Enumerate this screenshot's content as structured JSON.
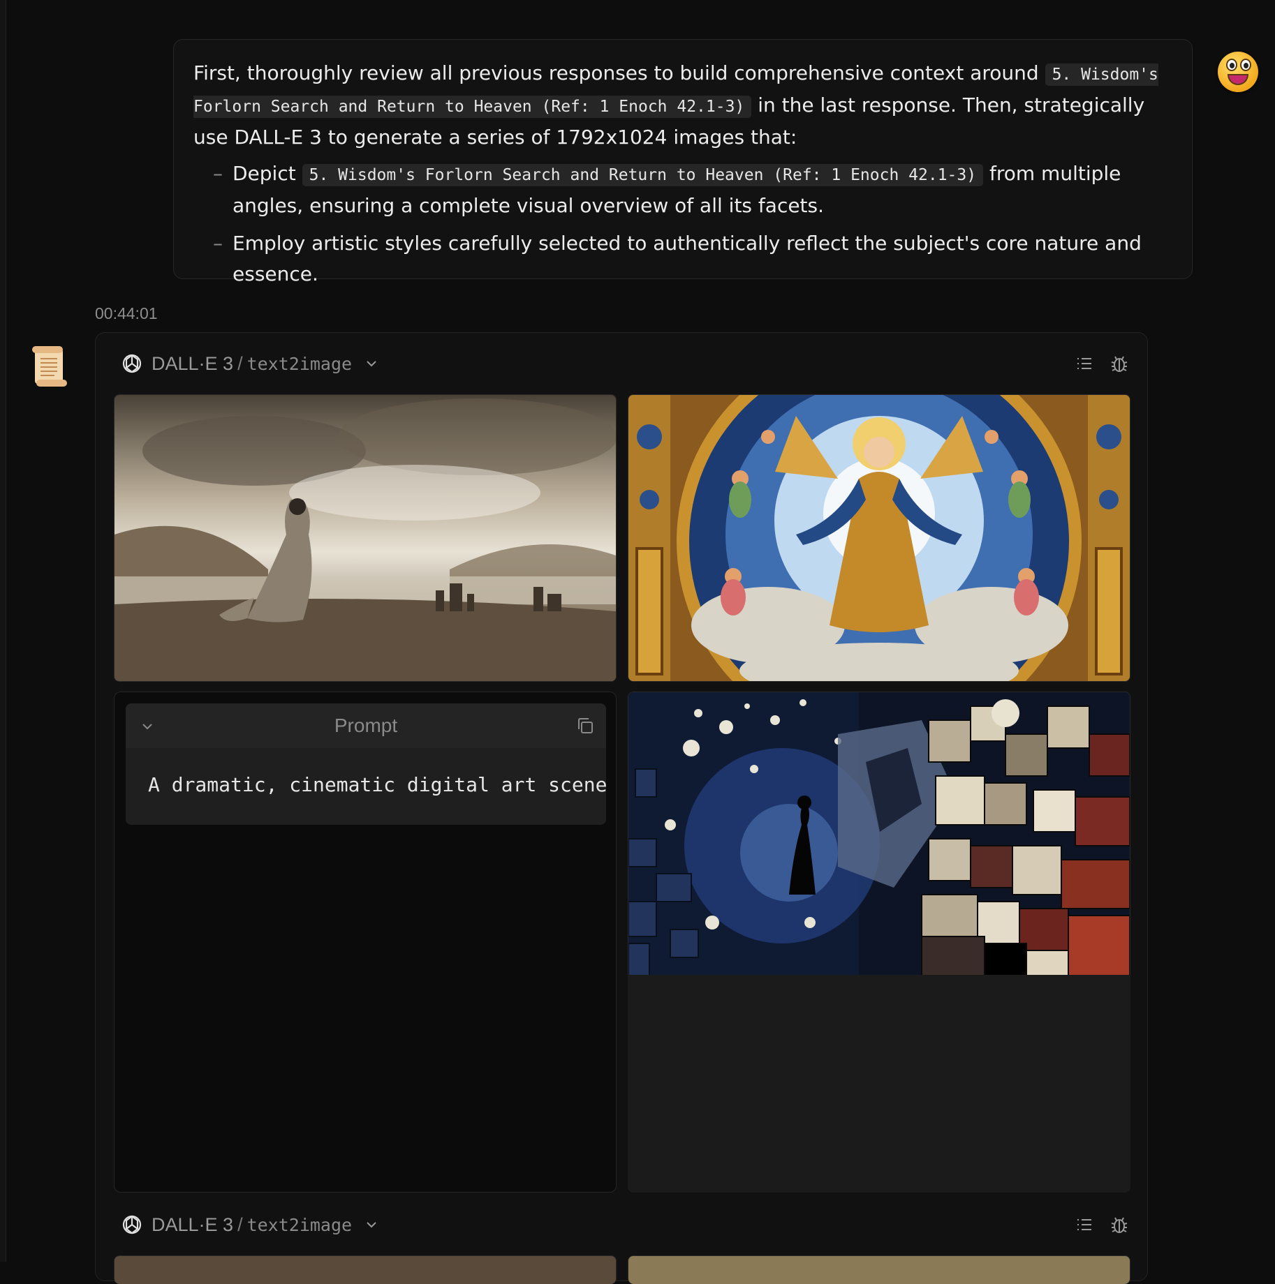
{
  "user_message": {
    "intro_before": "First, thoroughly review all previous responses to build comprehensive context around",
    "ref_code": "5. Wisdom's Forlorn Search and Return to Heaven (Ref: 1 Enoch 42.1-3)",
    "intro_after": "in the last response. Then, strategically use DALL-E 3 to generate a series of 1792x1024 images that:",
    "bullets": [
      {
        "dash": "–",
        "before": "Depict",
        "code": "5. Wisdom's Forlorn Search and Return to Heaven (Ref: 1 Enoch 42.1-3)",
        "after": "from multiple angles, ensuring a complete visual overview of all its facets."
      },
      {
        "dash": "–",
        "text": "Employ artistic styles carefully selected to authentically reflect the subject's core nature and essence."
      }
    ]
  },
  "assistant": {
    "timestamp": "00:44:01",
    "tool_calls": [
      {
        "model": "DALL·E 3",
        "separator": "/",
        "plugin": "text2image"
      },
      {
        "model": "DALL·E 3",
        "separator": "/",
        "plugin": "text2image"
      }
    ],
    "prompt_panel": {
      "title": "Prompt",
      "text": "A dramatic, cinematic digital art scene"
    }
  },
  "icons": {
    "user_avatar": "grinning-face-emoji",
    "assistant_avatar": "scroll-emoji",
    "tool_logo": "openai-logo-icon",
    "dropdown": "chevron-down-icon",
    "list": "list-icon",
    "debug": "bug-icon",
    "copy": "copy-icon"
  },
  "colors": {
    "background": "#0d0d0d",
    "card": "#111111",
    "text": "#e8e8e8",
    "muted": "#8e8e8e"
  }
}
